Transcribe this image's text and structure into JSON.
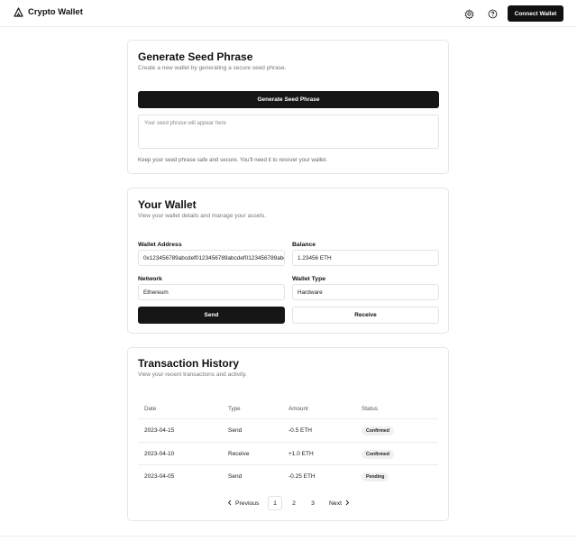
{
  "header": {
    "title": "Crypto Wallet",
    "logo_icon": "triangle-logo-icon",
    "settings_icon": "gear-icon",
    "help_icon": "help-circle-icon",
    "connect_label": "Connect Wallet"
  },
  "seed": {
    "title": "Generate Seed Phrase",
    "subtitle": "Create a new wallet by generating a secure seed phrase.",
    "button_label": "Generate Seed Phrase",
    "textarea_placeholder": "Your seed phrase will appear here",
    "note": "Keep your seed phrase safe and secure. You'll need it to recover your wallet."
  },
  "wallet": {
    "title": "Your Wallet",
    "subtitle": "View your wallet details and manage your assets.",
    "address_label": "Wallet Address",
    "address_value": "0x123456789abcdef0123456789abcdef0123456789abcdef",
    "balance_label": "Balance",
    "balance_value": "1.23456 ETH",
    "network_label": "Network",
    "network_value": "Ethereum",
    "type_label": "Wallet Type",
    "type_value": "Hardware",
    "send_label": "Send",
    "receive_label": "Receive"
  },
  "history": {
    "title": "Transaction History",
    "subtitle": "View your recent transactions and activity.",
    "columns": [
      "Date",
      "Type",
      "Amount",
      "Status"
    ],
    "rows": [
      {
        "date": "2023-04-15",
        "type": "Send",
        "amount": "-0.5 ETH",
        "status": "Confirmed"
      },
      {
        "date": "2023-04-10",
        "type": "Receive",
        "amount": "+1.0 ETH",
        "status": "Confirmed"
      },
      {
        "date": "2023-04-05",
        "type": "Send",
        "amount": "-0.25 ETH",
        "status": "Pending"
      }
    ],
    "pagination": {
      "previous": "Previous",
      "next": "Next",
      "pages": [
        "1",
        "2",
        "3"
      ],
      "current": "1"
    }
  }
}
